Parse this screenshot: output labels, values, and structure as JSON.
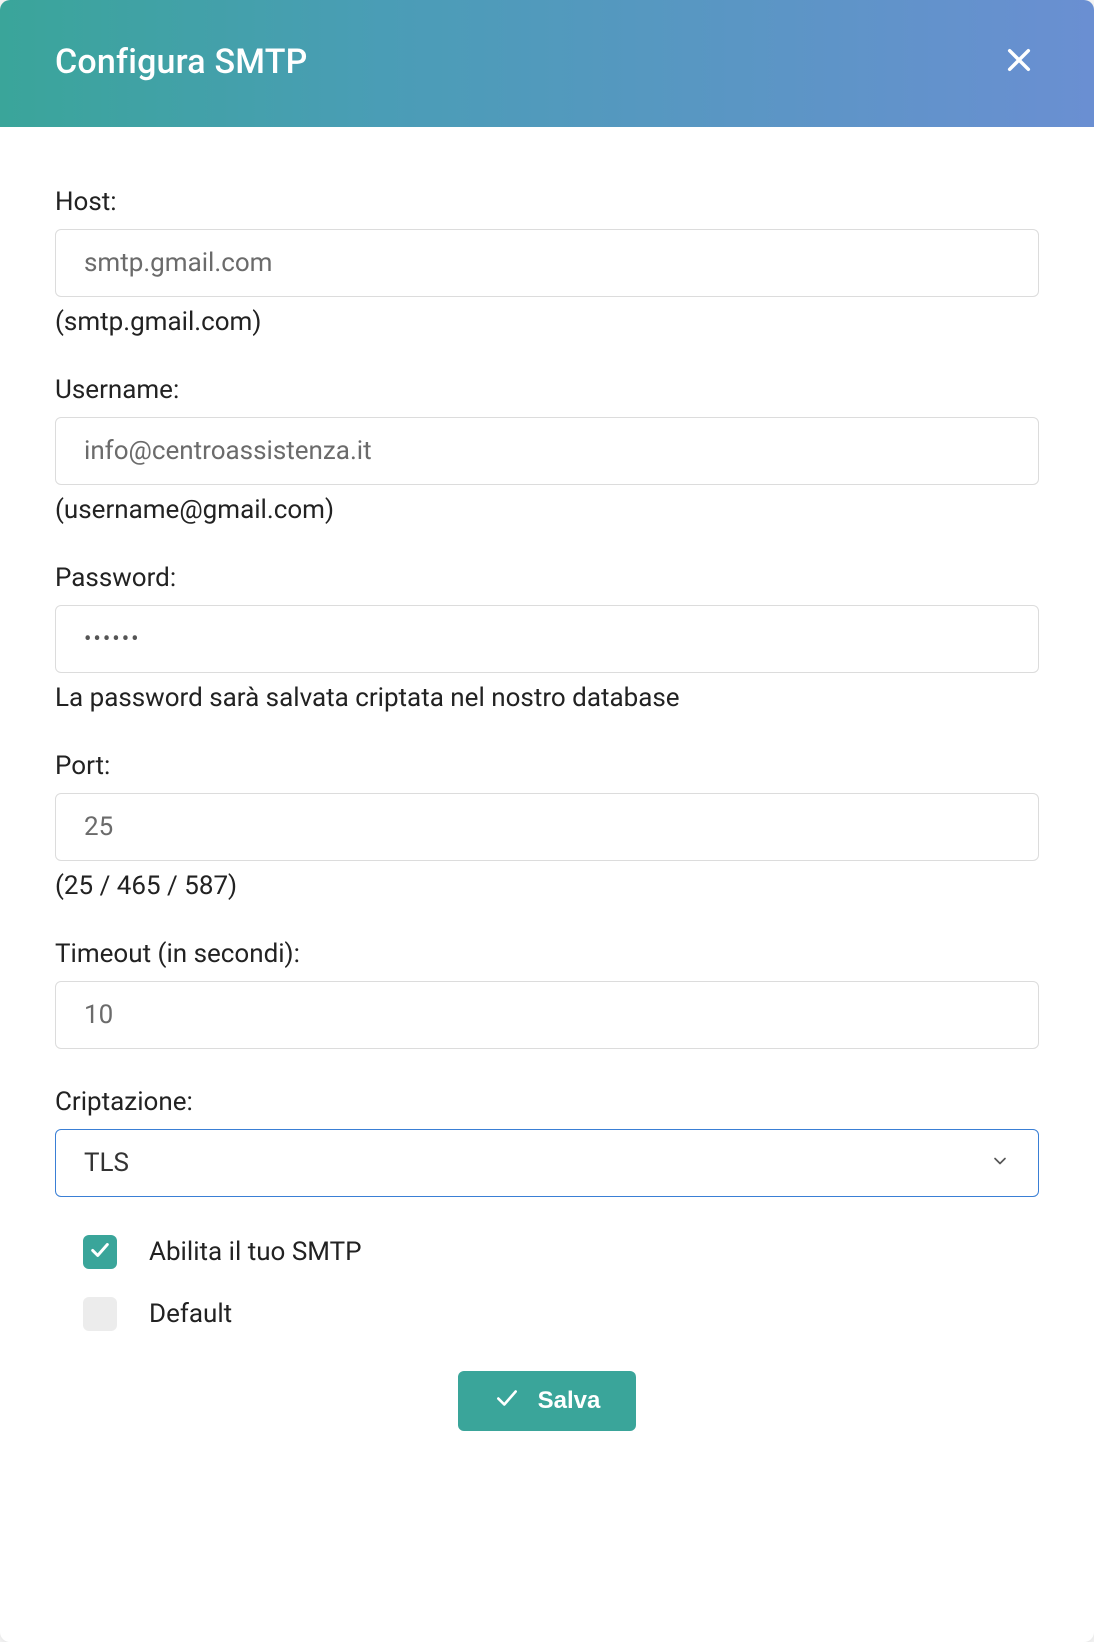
{
  "header": {
    "title": "Configura SMTP"
  },
  "fields": {
    "host": {
      "label": "Host:",
      "placeholder": "smtp.gmail.com",
      "value": "",
      "hint": "(smtp.gmail.com)"
    },
    "username": {
      "label": "Username:",
      "placeholder": "info@centroassistenza.it",
      "value": "",
      "hint": "(username@gmail.com)"
    },
    "password": {
      "label": "Password:",
      "value": "••••••",
      "hint": "La password sarà salvata criptata nel nostro database"
    },
    "port": {
      "label": "Port:",
      "placeholder": "25",
      "value": "",
      "hint": "(25 / 465 / 587)"
    },
    "timeout": {
      "label": "Timeout (in secondi):",
      "placeholder": "10",
      "value": ""
    },
    "encryption": {
      "label": "Criptazione:",
      "value": "TLS"
    }
  },
  "checkboxes": {
    "enable": {
      "label": "Abilita il tuo SMTP",
      "checked": true
    },
    "default": {
      "label": "Default",
      "checked": false
    }
  },
  "actions": {
    "save": "Salva"
  }
}
